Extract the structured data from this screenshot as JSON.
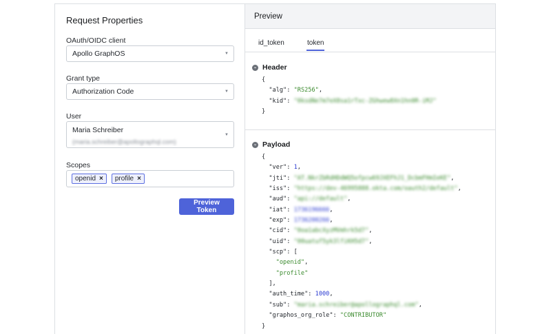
{
  "left": {
    "title": "Request Properties",
    "client_label": "OAuth/OIDC client",
    "client_value": "Apollo GraphOS",
    "grant_label": "Grant type",
    "grant_value": "Authorization Code",
    "user_label": "User",
    "user_name": "Maria Schreiber",
    "user_email": "(maria.schreiber@apollographql.com)",
    "scopes_label": "Scopes",
    "scopes": [
      "openid",
      "profile"
    ],
    "remove_glyph": "×",
    "caret_glyph": "▼",
    "button_label": "Preview Token"
  },
  "preview": {
    "title": "Preview",
    "tabs": [
      "id_token",
      "token"
    ],
    "active_tab": "token",
    "header_title": "Header",
    "payload_title": "Payload",
    "toggle_glyph": "⌄",
    "header_lines": {
      "open": "{",
      "alg_key": "\"alg\"",
      "alg_val": "\"RS256\"",
      "kid_key": "\"kid\"",
      "kid_val": "\"0ksdNe7m7eX8sa1rTxc-ZGhwew8Xn1hn0R-iMJ\"",
      "close": "}"
    },
    "payload_lines": {
      "open": "{",
      "ver_key": "\"ver\"",
      "ver_val": "1",
      "jti_key": "\"jti\"",
      "jti_val": "\"AT.NkrZbRdHDdWQ5ofpcw69JXEFhJ1_DcbmFHmIeKE\"",
      "iss_key": "\"iss\"",
      "iss_val": "\"https://dev-46995888.okta.com/oauth2/default\"",
      "aud_key": "\"aud\"",
      "aud_val": "\"api://default\"",
      "iat_key": "\"iat\"",
      "iat_val": "1736196666",
      "exp_key": "\"exp\"",
      "exp_val": "1736200266",
      "cid_key": "\"cid\"",
      "cid_val": "\"0oa1abcXyzMVmhrk5d7\"",
      "uid_key": "\"uid\"",
      "uid_val": "\"00uatuf5yk3lfiKH5d7\"",
      "scp_key": "\"scp\"",
      "scp_open": "[",
      "scp_items": [
        "\"openid\"",
        "\"profile\""
      ],
      "scp_close": "],",
      "auth_time_key": "\"auth_time\"",
      "auth_time_val": "1000",
      "sub_key": "\"sub\"",
      "sub_val": "\"maria.schreiber@apollographql.com\"",
      "role_key": "\"graphos_org_role\"",
      "role_val": "\"CONTRIBUTOR\"",
      "close": "}"
    }
  }
}
